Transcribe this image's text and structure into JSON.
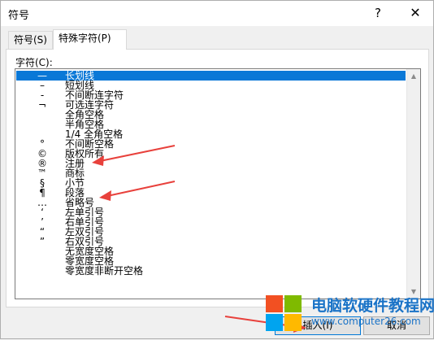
{
  "window": {
    "title": "符号",
    "help_label": "?",
    "close_label": "✕"
  },
  "tabs": [
    {
      "label": "符号(S)"
    },
    {
      "label": "特殊字符(P)"
    }
  ],
  "panel": {
    "char_label": "字符(C):"
  },
  "rows": [
    {
      "char": "—",
      "name": "长划线",
      "selected": true
    },
    {
      "char": "–",
      "name": "短划线"
    },
    {
      "char": "-",
      "name": "不间断连字符"
    },
    {
      "char": "¬",
      "name": "可选连字符"
    },
    {
      "char": "",
      "name": "全角空格"
    },
    {
      "char": "",
      "name": "半角空格"
    },
    {
      "char": "",
      "name": "1/4 全角空格"
    },
    {
      "char": "°",
      "name": "不间断空格"
    },
    {
      "char": "©",
      "name": "版权所有"
    },
    {
      "char": "®",
      "name": "注册"
    },
    {
      "char": "™",
      "name": "商标"
    },
    {
      "char": "§",
      "name": "小节"
    },
    {
      "char": "¶",
      "name": "段落"
    },
    {
      "char": "…",
      "name": "省略号"
    },
    {
      "char": "‘",
      "name": "左单引号"
    },
    {
      "char": "’",
      "name": "右单引号"
    },
    {
      "char": "“",
      "name": "左双引号"
    },
    {
      "char": "”",
      "name": "右双引号"
    },
    {
      "char": "",
      "name": "无宽度空格"
    },
    {
      "char": "",
      "name": "零宽度空格"
    },
    {
      "char": "",
      "name": "零宽度非断开空格"
    }
  ],
  "buttons": {
    "insert": "插入(I)",
    "cancel": "取消"
  },
  "watermark": {
    "title": "电脑软硬件教程网",
    "url": "www.computer26.com"
  },
  "colors": {
    "selection": "#0a78d7",
    "annotation_arrow": "#e8413c",
    "logo_red": "#f25022",
    "logo_green": "#7fba00",
    "logo_blue": "#00a4ef",
    "logo_yellow": "#ffb900"
  }
}
